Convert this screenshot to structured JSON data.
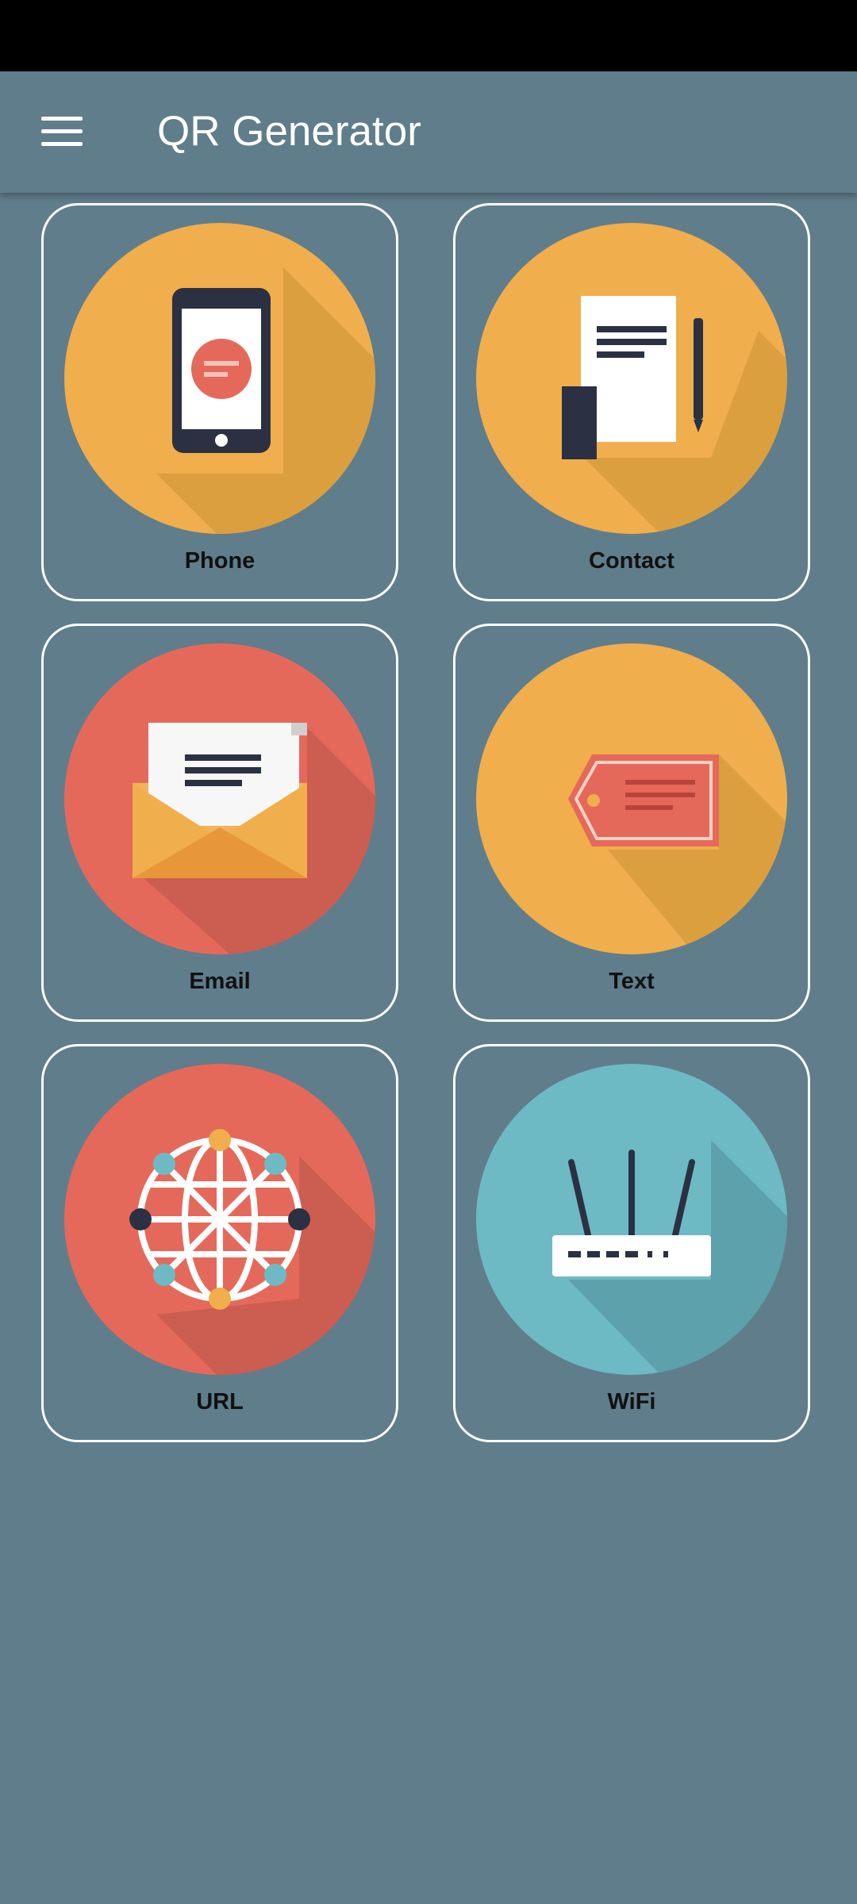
{
  "app": {
    "title": "QR Generator"
  },
  "colors": {
    "background": "#607d8b",
    "status_bar": "#000000",
    "card_border": "#ffffff",
    "orange_circle": "#f0ae4c",
    "red_circle": "#e5695b",
    "teal_circle": "#6dbac4"
  },
  "cards": [
    {
      "label": "Phone",
      "icon": "phone-icon"
    },
    {
      "label": "Contact",
      "icon": "contact-icon"
    },
    {
      "label": "Email",
      "icon": "email-icon"
    },
    {
      "label": "Text",
      "icon": "text-icon"
    },
    {
      "label": "URL",
      "icon": "url-icon"
    },
    {
      "label": "WiFi",
      "icon": "wifi-icon"
    }
  ]
}
